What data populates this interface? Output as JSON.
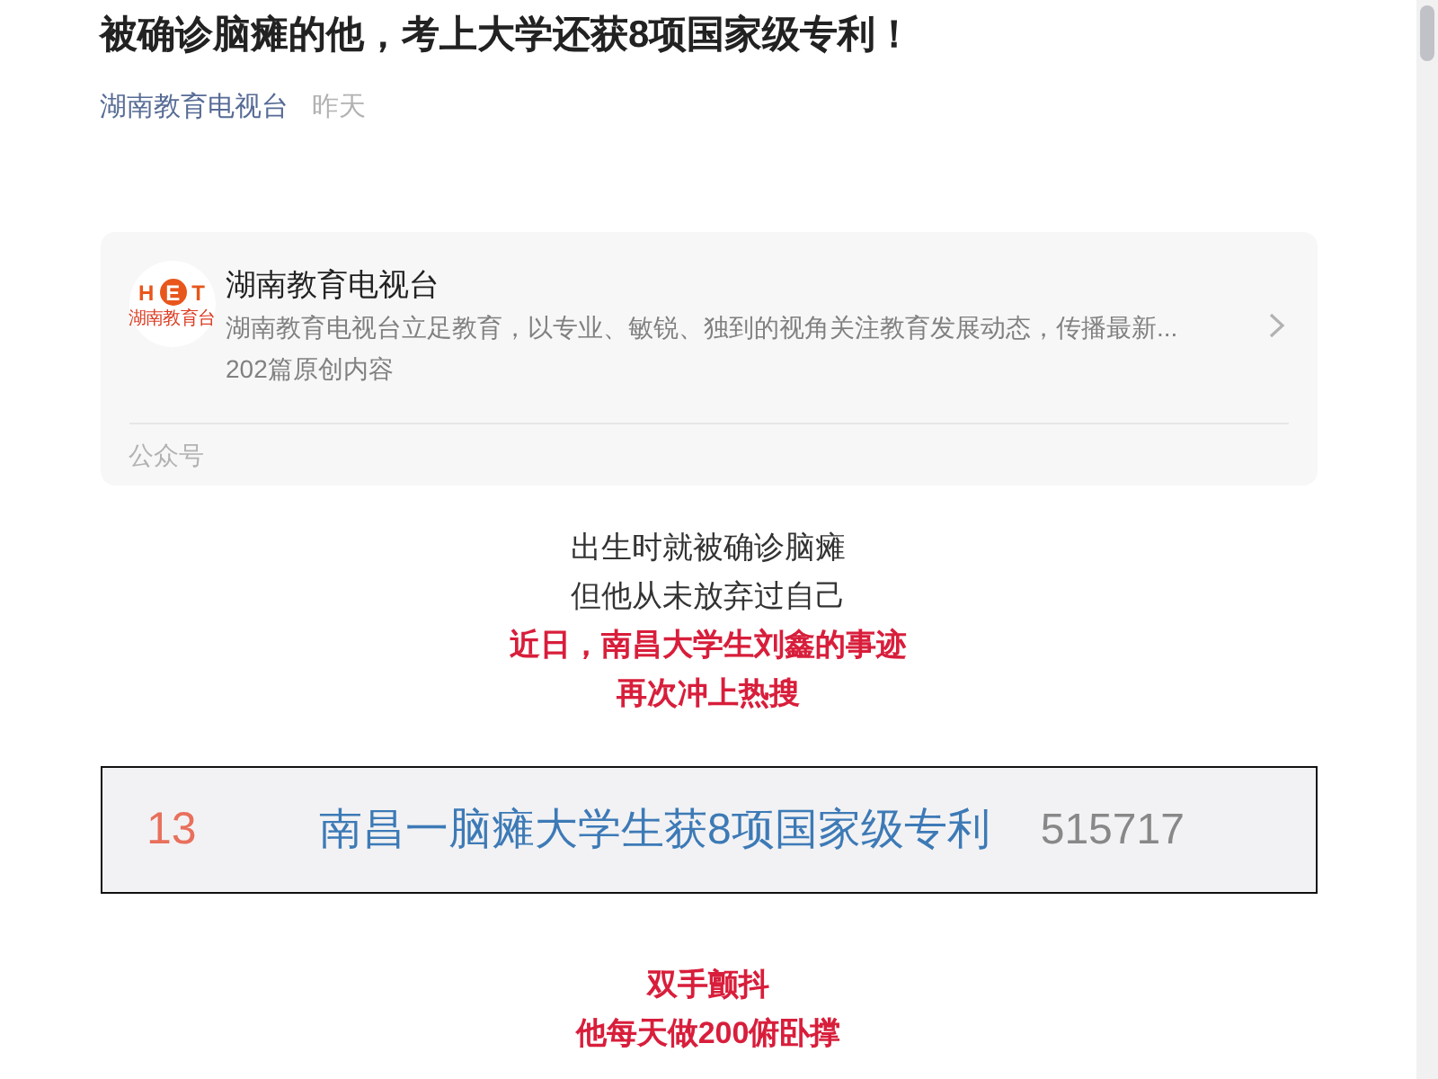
{
  "article": {
    "title": "被确诊脑瘫的他，考上大学还获8项国家级专利！",
    "author": "湖南教育电视台",
    "date": "昨天"
  },
  "account_card": {
    "logo": {
      "letters": [
        {
          "char": "H",
          "circled": false
        },
        {
          "char": "E",
          "circled": true
        },
        {
          "char": "T",
          "circled": false
        }
      ],
      "caption": "湖南教育台"
    },
    "name": "湖南教育电视台",
    "description": "湖南教育电视台立足教育，以专业、敏锐、独到的视角关注教育发展动态，传播最新...",
    "stats": "202篇原创内容",
    "footer": "公众号"
  },
  "content": [
    {
      "kind": "lines",
      "lines": [
        {
          "text": "出生时就被确诊脑瘫",
          "emphasis": false
        },
        {
          "text": "但他从未放弃过自己",
          "emphasis": false
        },
        {
          "text": "近日，南昌大学生刘鑫的事迹",
          "emphasis": true
        },
        {
          "text": "再次冲上热搜",
          "emphasis": true
        }
      ]
    },
    {
      "kind": "hot_search",
      "rank": "13",
      "title": "南昌一脑瘫大学生获8项国家级专利",
      "count": "515717"
    },
    {
      "kind": "lines",
      "lines": [
        {
          "text": "双手颤抖",
          "emphasis": true
        },
        {
          "text": "他每天做200俯卧撑",
          "emphasis": true
        }
      ]
    }
  ]
}
